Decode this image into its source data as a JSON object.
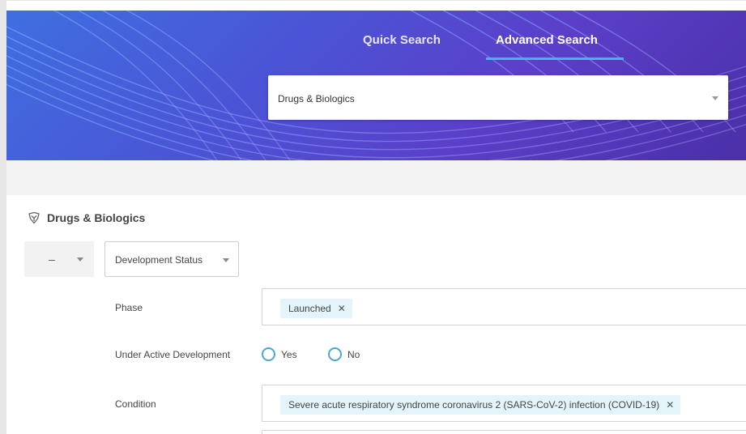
{
  "tabs": {
    "quick": "Quick Search",
    "advanced": "Advanced Search",
    "active": "advanced"
  },
  "category_select": {
    "value": "Drugs & Biologics"
  },
  "section": {
    "title": "Drugs & Biologics",
    "icon": "pill-capsule-icon"
  },
  "filter": {
    "operator": "–",
    "field": "Development Status"
  },
  "rows": {
    "phase": {
      "label": "Phase",
      "chips": [
        "Launched"
      ]
    },
    "active": {
      "label": "Under Active Development",
      "options": [
        "Yes",
        "No"
      ]
    },
    "condition": {
      "label": "Condition",
      "chips": [
        "Severe acute respiratory syndrome coronavirus 2 (SARS-CoV-2) infection (COVID-19)"
      ]
    }
  },
  "colors": {
    "accent": "#3fb6f0",
    "hero_start": "#3f6fe0",
    "hero_end": "#4a2fa8",
    "chip_bg": "#e3f5fb",
    "radio": "#4aa8d8"
  }
}
